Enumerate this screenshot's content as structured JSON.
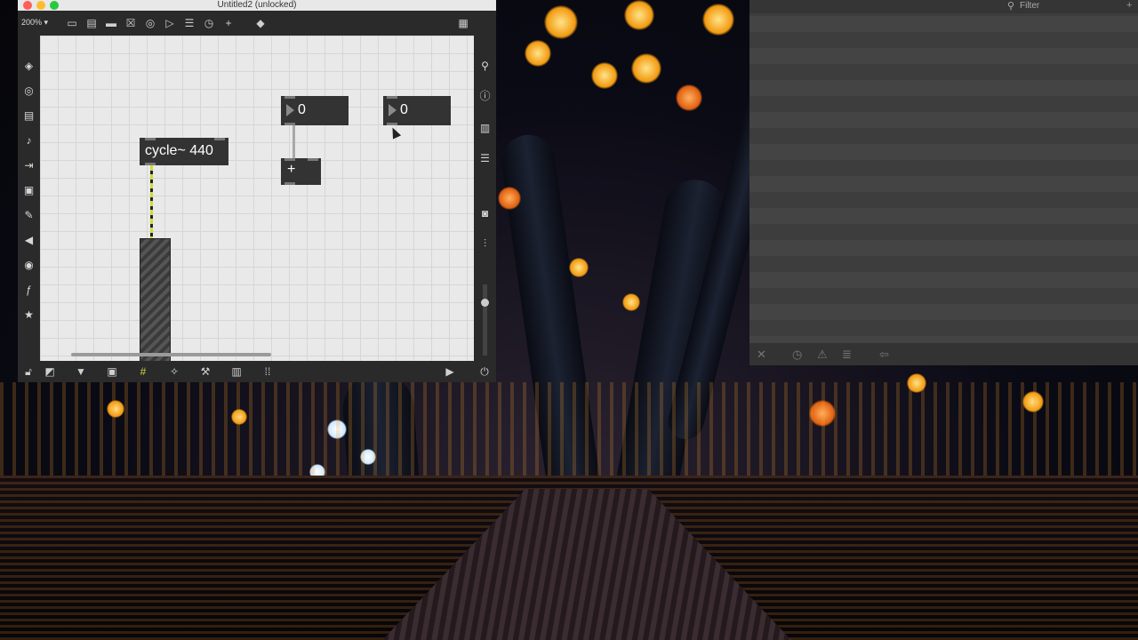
{
  "patcher": {
    "title": "Untitled2 (unlocked)",
    "zoom": "200%",
    "objects": {
      "cycle_label": "cycle~ 440",
      "number1_value": "0",
      "number2_value": "0",
      "plus_label": "+"
    }
  },
  "console": {
    "filter_placeholder": "Filter"
  },
  "colors": {
    "canvas_bg": "#e9e9e9",
    "object_bg": "#333333",
    "signal_cord": "#cddc39",
    "toolbar_bg": "#2a2a2a"
  }
}
